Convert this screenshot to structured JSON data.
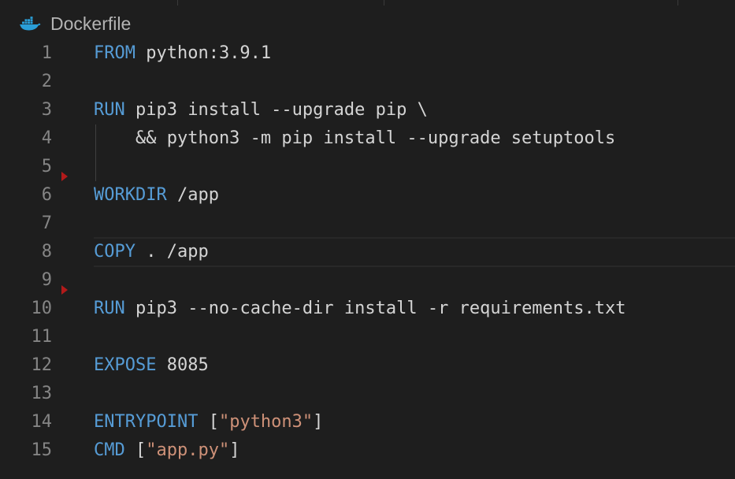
{
  "breadcrumb": {
    "icon": "docker-whale-icon",
    "filename": "Dockerfile"
  },
  "editor": {
    "current_line": 8,
    "lines": [
      {
        "num": "1",
        "tokens": [
          {
            "t": "kw",
            "v": "FROM"
          },
          {
            "t": "plain",
            "v": " python:3.9.1"
          }
        ]
      },
      {
        "num": "2",
        "tokens": []
      },
      {
        "num": "3",
        "tokens": [
          {
            "t": "kw",
            "v": "RUN"
          },
          {
            "t": "plain",
            "v": " pip3 install --upgrade pip \\"
          }
        ]
      },
      {
        "num": "4",
        "tokens": [
          {
            "t": "plain",
            "v": "    && python3 -m pip install --upgrade setuptools"
          }
        ]
      },
      {
        "num": "5",
        "tokens": []
      },
      {
        "num": "6",
        "tokens": [
          {
            "t": "kw",
            "v": "WORKDIR"
          },
          {
            "t": "plain",
            "v": " /app"
          }
        ]
      },
      {
        "num": "7",
        "tokens": []
      },
      {
        "num": "8",
        "tokens": [
          {
            "t": "kw",
            "v": "COPY"
          },
          {
            "t": "plain",
            "v": " . /app"
          }
        ]
      },
      {
        "num": "9",
        "tokens": []
      },
      {
        "num": "10",
        "tokens": [
          {
            "t": "kw",
            "v": "RUN"
          },
          {
            "t": "plain",
            "v": " pip3 --no-cache-dir install -r requirements.txt"
          }
        ]
      },
      {
        "num": "11",
        "tokens": []
      },
      {
        "num": "12",
        "tokens": [
          {
            "t": "kw",
            "v": "EXPOSE"
          },
          {
            "t": "plain",
            "v": " "
          },
          {
            "t": "plain",
            "v": "8085"
          }
        ]
      },
      {
        "num": "13",
        "tokens": []
      },
      {
        "num": "14",
        "tokens": [
          {
            "t": "kw",
            "v": "ENTRYPOINT"
          },
          {
            "t": "plain",
            "v": " ["
          },
          {
            "t": "str",
            "v": "\"python3\""
          },
          {
            "t": "plain",
            "v": "]"
          }
        ]
      },
      {
        "num": "15",
        "tokens": [
          {
            "t": "kw",
            "v": "CMD"
          },
          {
            "t": "plain",
            "v": " ["
          },
          {
            "t": "str",
            "v": "\"app.py\""
          },
          {
            "t": "plain",
            "v": "]"
          }
        ]
      }
    ],
    "markers": [
      "6",
      "10"
    ]
  },
  "colors": {
    "background": "#1e1e1e",
    "keyword": "#569cd6",
    "string": "#ce9178",
    "text": "#d4d4d4",
    "line_number": "#858585",
    "marker": "#b21a1a"
  }
}
